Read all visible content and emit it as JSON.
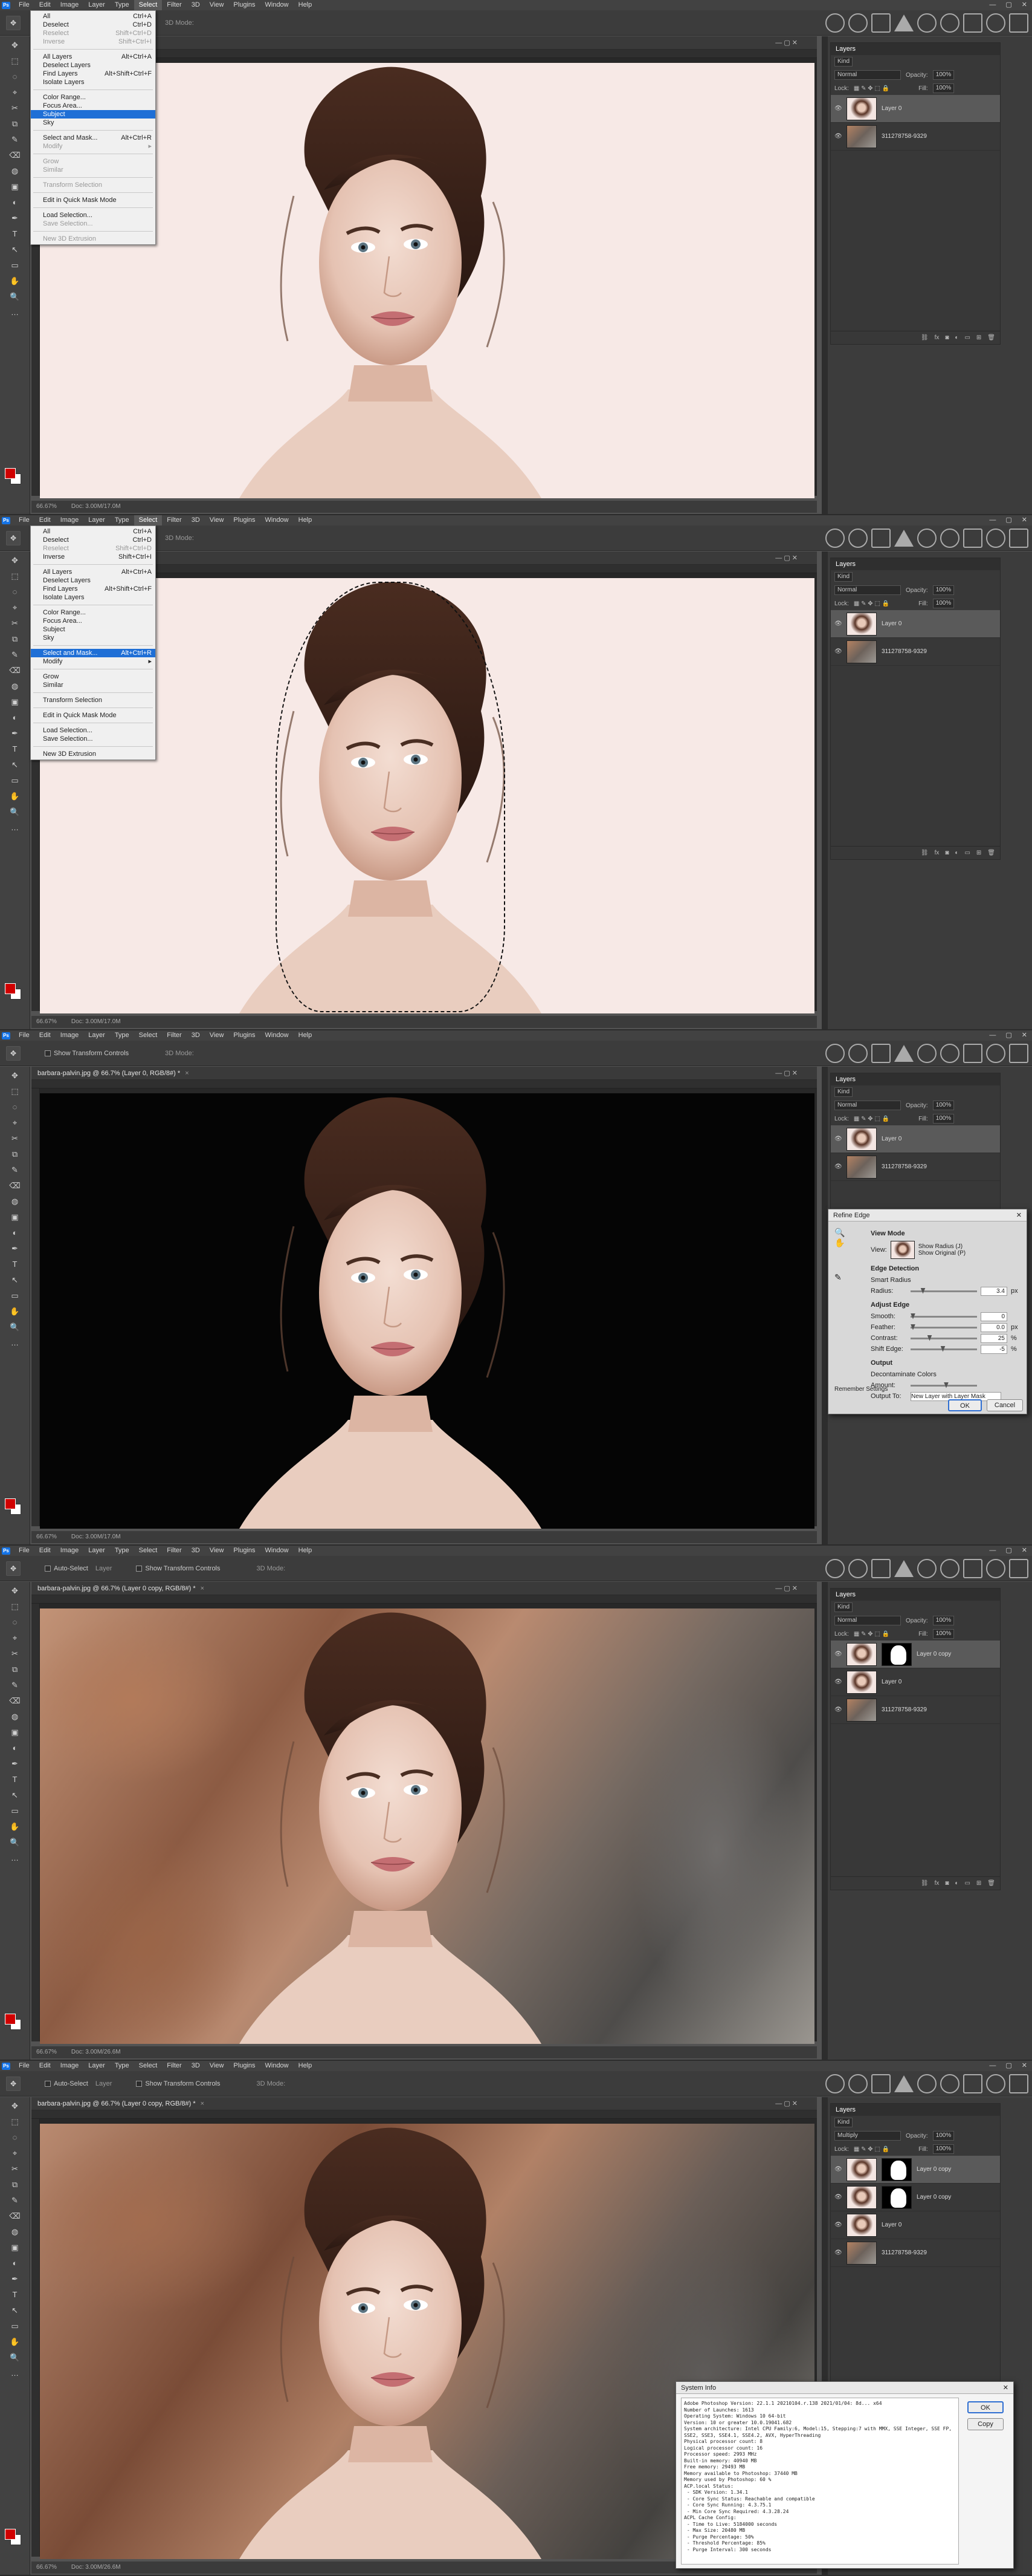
{
  "menu": [
    "File",
    "Edit",
    "Image",
    "Layer",
    "Type",
    "Select",
    "Filter",
    "3D",
    "View",
    "Plugins",
    "Window",
    "Help"
  ],
  "options": {
    "show_transform": "Show Transform Controls",
    "auto_select": "Auto-Select",
    "layer": "Layer",
    "mode3d": "3D Mode:"
  },
  "panel": {
    "layers_tab": "Layers",
    "kind": "Kind",
    "opacity_label": "Opacity:",
    "opacity_value": "100%",
    "lock_label": "Lock:",
    "fill_label": "Fill:",
    "fill_value": "100%"
  },
  "frames": [
    {
      "doc": "",
      "status_zoom": "66.67%",
      "status_doc": "Doc: 3.00M/17.0M",
      "blend": "Normal",
      "layers": [
        {
          "name": "Layer 0",
          "sel": true
        },
        {
          "name": "311278758-9329",
          "sel": false
        }
      ]
    },
    {
      "doc": "",
      "status_zoom": "66.67%",
      "status_doc": "Doc: 3.00M/17.0M",
      "blend": "Normal",
      "layers": [
        {
          "name": "Layer 0",
          "sel": true
        },
        {
          "name": "311278758-9329",
          "sel": false
        }
      ]
    },
    {
      "doc": "barbara-palvin.jpg @ 66.7% (Layer 0, RGB/8#) *",
      "status_zoom": "66.67%",
      "status_doc": "Doc: 3.00M/17.0M",
      "blend": "Normal",
      "layers": [
        {
          "name": "Layer 0",
          "sel": true
        },
        {
          "name": "311278758-9329",
          "sel": false
        }
      ]
    },
    {
      "doc": "barbara-palvin.jpg @ 66.7% (Layer 0 copy, RGB/8#) *",
      "status_zoom": "66.67%",
      "status_doc": "Doc: 3.00M/26.6M",
      "blend": "Normal",
      "layers": [
        {
          "name": "Layer 0 copy",
          "sel": true
        },
        {
          "name": "Layer 0",
          "sel": false
        },
        {
          "name": "311278758-9329",
          "sel": false
        }
      ]
    },
    {
      "doc": "barbara-palvin.jpg @ 66.7% (Layer 0 copy, RGB/8#) *",
      "status_zoom": "66.67%",
      "status_doc": "Doc: 3.00M/26.6M",
      "blend": "Multiply",
      "layers": [
        {
          "name": "Layer 0 copy",
          "sel": true
        },
        {
          "name": "Layer 0 copy",
          "sel": false
        },
        {
          "name": "Layer 0",
          "sel": false
        },
        {
          "name": "311278758-9329",
          "sel": false
        }
      ]
    }
  ],
  "select_menu_1": [
    {
      "label": "All",
      "key": "Ctrl+A"
    },
    {
      "label": "Deselect",
      "key": "Ctrl+D"
    },
    {
      "label": "Reselect",
      "key": "Shift+Ctrl+D",
      "dis": true
    },
    {
      "label": "Inverse",
      "key": "Shift+Ctrl+I",
      "dis": true
    },
    {
      "sep": true
    },
    {
      "label": "All Layers",
      "key": "Alt+Ctrl+A"
    },
    {
      "label": "Deselect Layers",
      "key": ""
    },
    {
      "label": "Find Layers",
      "key": "Alt+Shift+Ctrl+F"
    },
    {
      "label": "Isolate Layers",
      "key": ""
    },
    {
      "sep": true
    },
    {
      "label": "Color Range...",
      "key": ""
    },
    {
      "label": "Focus Area...",
      "key": ""
    },
    {
      "label": "Subject",
      "key": "",
      "hl": true
    },
    {
      "label": "Sky",
      "key": ""
    },
    {
      "sep": true
    },
    {
      "label": "Select and Mask...",
      "key": "Alt+Ctrl+R"
    },
    {
      "label": "Modify",
      "key": "▸",
      "dis": true
    },
    {
      "sep": true
    },
    {
      "label": "Grow",
      "key": "",
      "dis": true
    },
    {
      "label": "Similar",
      "key": "",
      "dis": true
    },
    {
      "sep": true
    },
    {
      "label": "Transform Selection",
      "key": "",
      "dis": true
    },
    {
      "sep": true
    },
    {
      "label": "Edit in Quick Mask Mode",
      "key": ""
    },
    {
      "sep": true
    },
    {
      "label": "Load Selection...",
      "key": ""
    },
    {
      "label": "Save Selection...",
      "key": "",
      "dis": true
    },
    {
      "sep": true
    },
    {
      "label": "New 3D Extrusion",
      "key": "",
      "dis": true
    }
  ],
  "select_menu_2": [
    {
      "label": "All",
      "key": "Ctrl+A"
    },
    {
      "label": "Deselect",
      "key": "Ctrl+D"
    },
    {
      "label": "Reselect",
      "key": "Shift+Ctrl+D",
      "dis": true
    },
    {
      "label": "Inverse",
      "key": "Shift+Ctrl+I"
    },
    {
      "sep": true
    },
    {
      "label": "All Layers",
      "key": "Alt+Ctrl+A"
    },
    {
      "label": "Deselect Layers",
      "key": ""
    },
    {
      "label": "Find Layers",
      "key": "Alt+Shift+Ctrl+F"
    },
    {
      "label": "Isolate Layers",
      "key": ""
    },
    {
      "sep": true
    },
    {
      "label": "Color Range...",
      "key": ""
    },
    {
      "label": "Focus Area...",
      "key": ""
    },
    {
      "label": "Subject",
      "key": ""
    },
    {
      "label": "Sky",
      "key": ""
    },
    {
      "sep": true
    },
    {
      "label": "Select and Mask...",
      "key": "Alt+Ctrl+R",
      "hl": true
    },
    {
      "label": "Modify",
      "key": "▸"
    },
    {
      "sep": true
    },
    {
      "label": "Grow",
      "key": ""
    },
    {
      "label": "Similar",
      "key": ""
    },
    {
      "sep": true
    },
    {
      "label": "Transform Selection",
      "key": ""
    },
    {
      "sep": true
    },
    {
      "label": "Edit in Quick Mask Mode",
      "key": ""
    },
    {
      "sep": true
    },
    {
      "label": "Load Selection...",
      "key": ""
    },
    {
      "label": "Save Selection...",
      "key": ""
    },
    {
      "sep": true
    },
    {
      "label": "New 3D Extrusion",
      "key": ""
    }
  ],
  "refine": {
    "title": "Refine Edge",
    "view_mode": "View Mode",
    "view_label": "View:",
    "show_radius": "Show Radius (J)",
    "show_original": "Show Original (P)",
    "edge_detection": "Edge Detection",
    "smart_radius": "Smart Radius",
    "radius_label": "Radius:",
    "radius_value": "3.4",
    "radius_unit": "px",
    "adjust_edge": "Adjust Edge",
    "smooth_label": "Smooth:",
    "smooth_value": "0",
    "feather_label": "Feather:",
    "feather_value": "0.0",
    "feather_unit": "px",
    "contrast_label": "Contrast:",
    "contrast_value": "25",
    "shift_label": "Shift Edge:",
    "shift_value": "-5",
    "pct": "%",
    "output": "Output",
    "decontaminate": "Decontaminate Colors",
    "amount_label": "Amount:",
    "output_label": "Output To:",
    "output_value": "New Layer with Layer Mask",
    "remember": "Remember Settings",
    "ok": "OK",
    "cancel": "Cancel"
  },
  "sysinfo": {
    "title": "System Info",
    "ok": "OK",
    "copy": "Copy",
    "text": "Adobe Photoshop Version: 22.1.1 20210104.r.138 2021/01/04: 8d... x64\nNumber of Launches: 1613\nOperating System: Windows 10 64-bit\nVersion: 10 or greater 10.0.19041.682\nSystem architecture: Intel CPU Family:6, Model:15, Stepping:7 with MMX, SSE Integer, SSE FP,\nSSE2, SSE3, SSE4.1, SSE4.2, AVX, HyperThreading\nPhysical processor count: 8\nLogical processor count: 16\nProcessor speed: 2993 MHz\nBuilt-in memory: 40940 MB\nFree memory: 29493 MB\nMemory available to Photoshop: 37440 MB\nMemory used by Photoshop: 60 %\nACP.local Status:\n - SDK Version: 1.34.1\n - Core Sync Status: Reachable and compatible\n - Core Sync Running: 4.3.75.1\n - Min Core Sync Required: 4.3.28.24\nACPL Cache Config:\n - Time to Live: 5184000 seconds\n - Max Size: 20480 MB\n - Purge Percentage: 50%\n - Threshold Percentage: 85%\n - Purge Interval: 300 seconds"
  }
}
